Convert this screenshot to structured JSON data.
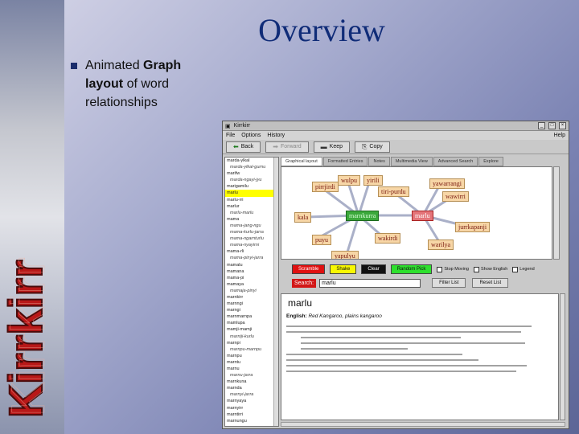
{
  "slide": {
    "title": "Overview",
    "bullet": {
      "pre": "Animated ",
      "bold1": "Graph layout",
      "post": " of word relationships"
    }
  },
  "app": {
    "window_title": "Kirrkirr",
    "menu": [
      "File",
      "Options",
      "History"
    ],
    "help_label": "Help",
    "toolbar": {
      "back": "Back",
      "forward": "Forward",
      "keep": "Keep",
      "copy": "Copy"
    },
    "wordlist": [
      {
        "text": "marda-ylkal",
        "type": "main"
      },
      {
        "text": "marda-ylkal-gurnu",
        "type": "sub"
      },
      {
        "text": "marifw",
        "type": "main"
      },
      {
        "text": "marda-ngayi-jyu",
        "type": "sub"
      },
      {
        "text": "marigamilu",
        "type": "main"
      },
      {
        "text": "marlu",
        "type": "selected"
      },
      {
        "text": "marlu-rri",
        "type": "main"
      },
      {
        "text": "marlur",
        "type": "main"
      },
      {
        "text": "marlu-marlu",
        "type": "sub"
      },
      {
        "text": "mama",
        "type": "main"
      },
      {
        "text": "mama-jang-ngu",
        "type": "sub"
      },
      {
        "text": "mama-kurlu-jarra",
        "type": "sub"
      },
      {
        "text": "mama-ngarnturlu",
        "type": "sub"
      },
      {
        "text": "mama-nyayirni",
        "type": "sub"
      },
      {
        "text": "mama-rli",
        "type": "main"
      },
      {
        "text": "mama-pinyi-jarra",
        "type": "sub"
      },
      {
        "text": "mamalu",
        "type": "main"
      },
      {
        "text": "mamana",
        "type": "main"
      },
      {
        "text": "mama-pi",
        "type": "main"
      },
      {
        "text": "mamaya",
        "type": "main"
      },
      {
        "text": "mamaja-pinyi",
        "type": "sub"
      },
      {
        "text": "marnkirr",
        "type": "main"
      },
      {
        "text": "marnngi",
        "type": "main"
      },
      {
        "text": "marngi",
        "type": "main"
      },
      {
        "text": "marnmarnpa",
        "type": "main"
      },
      {
        "text": "mamlupa",
        "type": "main"
      },
      {
        "text": "mamji-mamji",
        "type": "main"
      },
      {
        "text": "marniji-kurlu",
        "type": "sub"
      },
      {
        "text": "marnpi",
        "type": "main"
      },
      {
        "text": "marnpu-marnpu",
        "type": "sub"
      },
      {
        "text": "marnpu",
        "type": "main"
      },
      {
        "text": "marntu",
        "type": "main"
      },
      {
        "text": "marnu",
        "type": "main"
      },
      {
        "text": "marnu-jarra",
        "type": "sub"
      },
      {
        "text": "marnkuna",
        "type": "main"
      },
      {
        "text": "marnda",
        "type": "main"
      },
      {
        "text": "marnyi-jarra",
        "type": "sub"
      },
      {
        "text": "marnyaya",
        "type": "main"
      },
      {
        "text": "marnyirr",
        "type": "main"
      },
      {
        "text": "marntirri",
        "type": "main"
      },
      {
        "text": "marnungu",
        "type": "main"
      }
    ],
    "tabs": [
      "Graphical layout",
      "Formatted Entries",
      "Notes",
      "Multimedia View",
      "Advanced Search",
      "Explore"
    ],
    "graph_nodes": {
      "center": "marnkurra",
      "focus": "marlu",
      "n1": "pirrjirdi",
      "n2": "wulpu",
      "n3": "yirili",
      "n4": "tiri-purdu",
      "n5": "yawarrangi",
      "n6": "wawirri",
      "n7": "kala",
      "n8": "jurrkapanji",
      "n9": "puyu",
      "n10": "wakirdi",
      "n11": "warilya",
      "n12": "yapulyu"
    },
    "controls": {
      "scramble": "Scramble",
      "shake": "Shake",
      "clear": "Clear",
      "random_pick": "Random Pick",
      "stop_moving": "Stop Moving",
      "show_english": "Show English",
      "legend": "Legend"
    },
    "search": {
      "label": "Search:",
      "value": "marlu",
      "filter_list": "Filter List",
      "reset_list": "Reset List"
    },
    "entry": {
      "headword": "marlu",
      "english_label": "English:",
      "english_value": "Red Kangaroo, plains kangaroo"
    }
  }
}
